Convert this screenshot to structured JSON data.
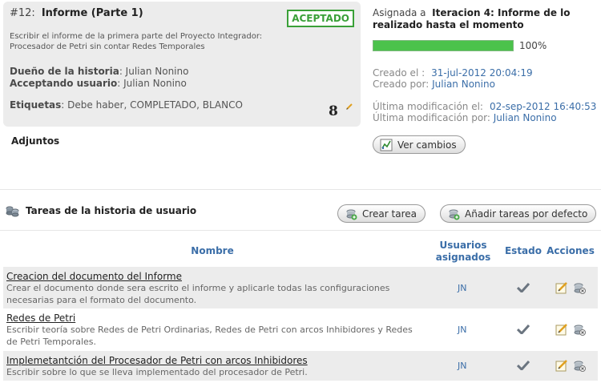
{
  "story": {
    "ref": "#12:",
    "title": "Informe (Parte 1)",
    "status": "ACEPTADO",
    "description": "Escribir el informe de la primera parte del Proyecto Integrador: Procesador de Petri sin contar Redes Temporales",
    "owner_label": "Dueño de la historia",
    "owner": ": Julian Nonino",
    "accepting_label": "Acceptando usuario",
    "accepting": ": Julian Nonino",
    "tags_label": "Etiquetas",
    "tags": ": Debe haber, COMPLETADO, BLANCO",
    "points": "8"
  },
  "attachments_label": "Adjuntos",
  "assignment": {
    "prefix": "Asignada a",
    "iteration": "Iteracion 4: Informe de lo realizado hasta el momento",
    "progress": 100,
    "progress_label": "100%"
  },
  "meta": {
    "created_on_label": "Creado el :",
    "created_on": "31-jul-2012 20:04:19",
    "created_by_label": "Creado por:",
    "created_by": "Julian Nonino",
    "modified_on_label": "Última modificación el:",
    "modified_on": "02-sep-2012 16:40:53",
    "modified_by_label": "Última modificación por:",
    "modified_by": "Julian Nonino"
  },
  "buttons": {
    "view_changes": "Ver cambios",
    "create_task": "Crear tarea",
    "add_default_tasks": "Añadir tareas por defecto"
  },
  "tasks_section_title": "Tareas de la historia de usuario",
  "table": {
    "col_name": "Nombre",
    "col_users": "Usuarios asignados",
    "col_state": "Estado",
    "col_actions": "Acciones",
    "rows": [
      {
        "name": "Creacion del documento del Informe",
        "description": "Crear el documento donde sera escrito el informe y aplicarle todas las configuraciones necesarias para el formato del documento.",
        "user": "JN"
      },
      {
        "name": "Redes de Petri",
        "description": "Escribir teoría sobre Redes de Petri Ordinarias, Redes de Petri con arcos Inhibidores y Redes de Petri Temporales.",
        "user": "JN"
      },
      {
        "name": "Implemetantción del Procesador de Petri con arcos Inhibidores",
        "description": "Escribir sobre lo que se lleva implementado del procesador de Petri.",
        "user": "JN"
      }
    ]
  },
  "colors": {
    "accent": "#3b6ea8",
    "accepted": "#3aa038",
    "progress": "#4bc24b"
  }
}
